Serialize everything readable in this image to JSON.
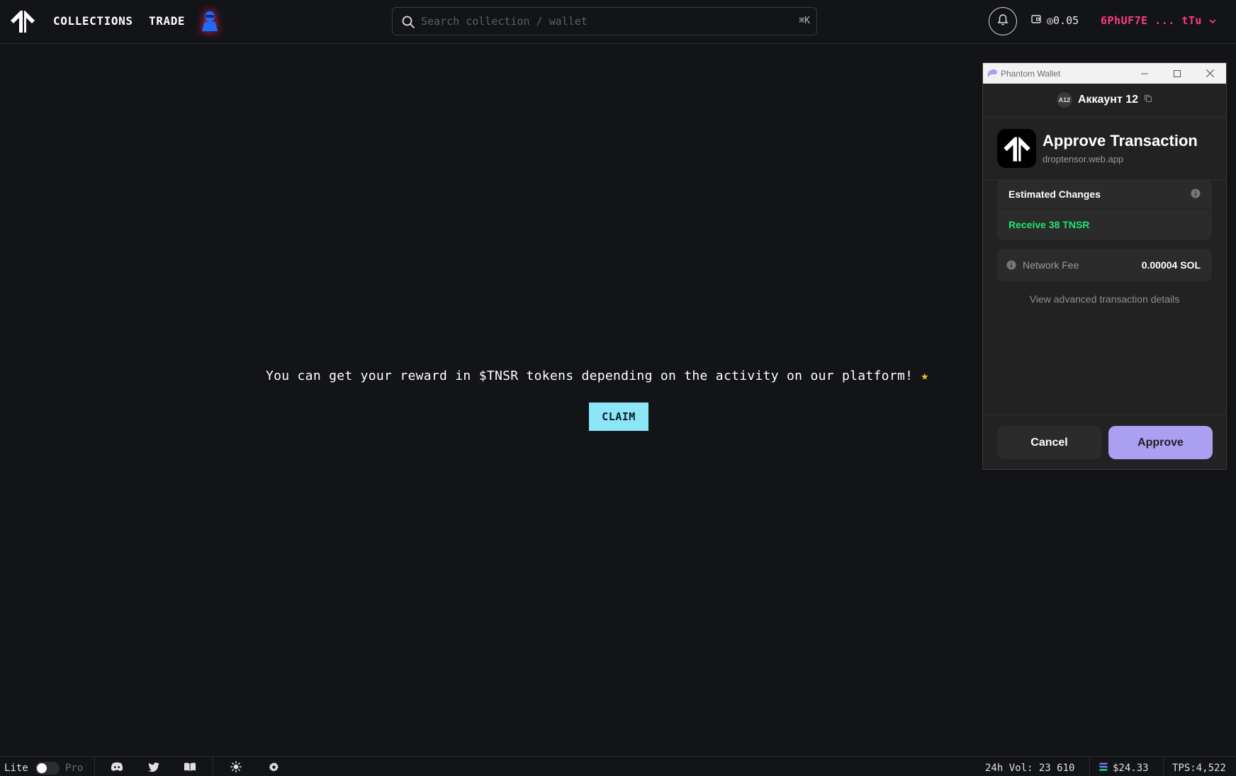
{
  "colors": {
    "background": "#131418",
    "wallet_address": "#ff3d7a",
    "claim_button": "#8be6f7",
    "phantom_accent": "#ab9ff2",
    "receive_green": "#21e56f",
    "star": "#f5c518"
  },
  "topbar": {
    "logo_icon": "tensor-logo-icon",
    "nav": {
      "collections": "COLLECTIONS",
      "trade": "TRADE"
    },
    "hero_icon": "user-hero-icon",
    "search": {
      "placeholder": "Search collection / wallet",
      "shortcut": "⌘K"
    },
    "bell_icon": "bell-icon",
    "balance": "◎0.05",
    "wallet_address": "6PhUF7E ... tTu"
  },
  "main": {
    "promo_text": "You can get your reward in $TNSR tokens depending on the activity on our platform!",
    "promo_star": "★",
    "claim_label": "CLAIM"
  },
  "phantom": {
    "window_title": "Phantom Wallet",
    "account_badge": "A12",
    "account_name": "Аккаунт 12",
    "approve_title": "Approve Transaction",
    "domain": "droptensor.web.app",
    "estimated_changes_label": "Estimated Changes",
    "receive_text": "Receive 38 TNSR",
    "network_fee_label": "Network Fee",
    "network_fee_value": "0.00004 SOL",
    "advanced_link": "View advanced transaction details",
    "cancel_label": "Cancel",
    "approve_label": "Approve"
  },
  "bottombar": {
    "lite_label": "Lite",
    "pro_label": "Pro",
    "volume": "24h Vol: 23 610",
    "sol_price": "$24.33",
    "tps": "TPS:4,522"
  }
}
